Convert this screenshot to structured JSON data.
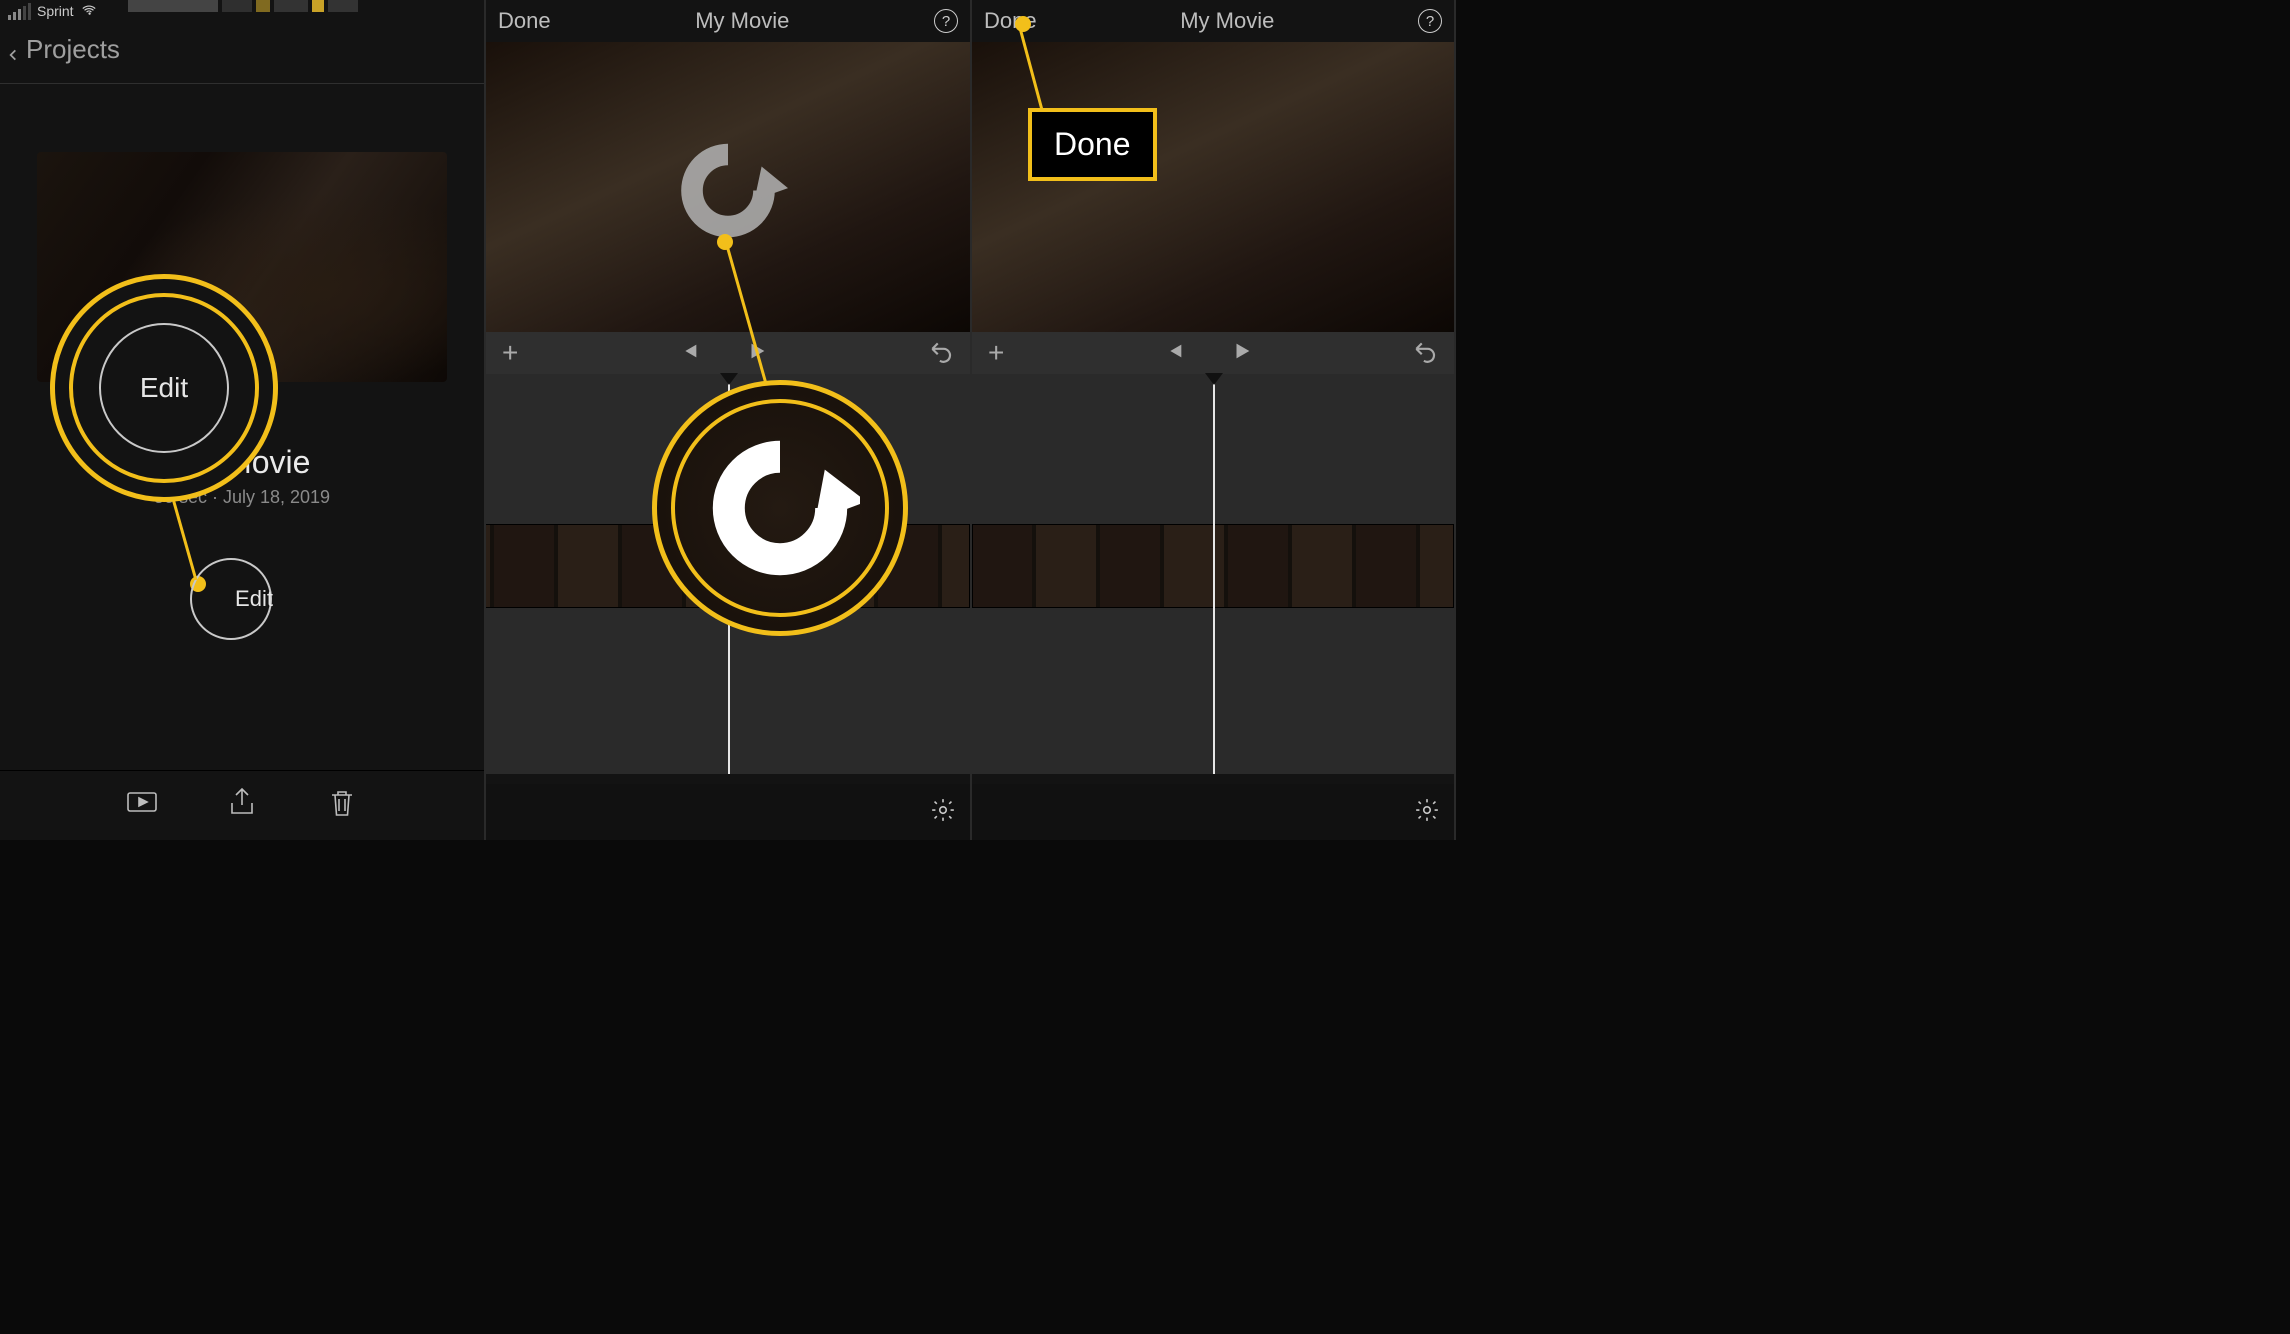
{
  "accent": "#f2bf1a",
  "statusbar": {
    "carrier": "Sprint"
  },
  "panel1": {
    "back_label": "Projects",
    "project": {
      "title": "My Movie",
      "subtitle": "50 sec · July 18, 2019"
    },
    "edit_label": "Edit",
    "callout_small_label": "Edit",
    "toolbar": {
      "play_icon": "play-to-tv-icon",
      "share_icon": "share-icon",
      "trash_icon": "trash-icon"
    }
  },
  "panel2": {
    "done_label": "Done",
    "title": "My Movie",
    "help_label": "?",
    "controls": {
      "add": "+",
      "prev": "skip-back-icon",
      "play": "play-icon",
      "undo": "undo-icon"
    },
    "settings_icon": "gear-icon",
    "rotate_icon": "rotate-clockwise-icon"
  },
  "panel3": {
    "done_label": "Done",
    "title": "My Movie",
    "help_label": "?",
    "callout_label": "Done",
    "controls": {
      "add": "+",
      "prev": "skip-back-icon",
      "play": "play-icon",
      "undo": "undo-icon"
    },
    "settings_icon": "gear-icon"
  }
}
